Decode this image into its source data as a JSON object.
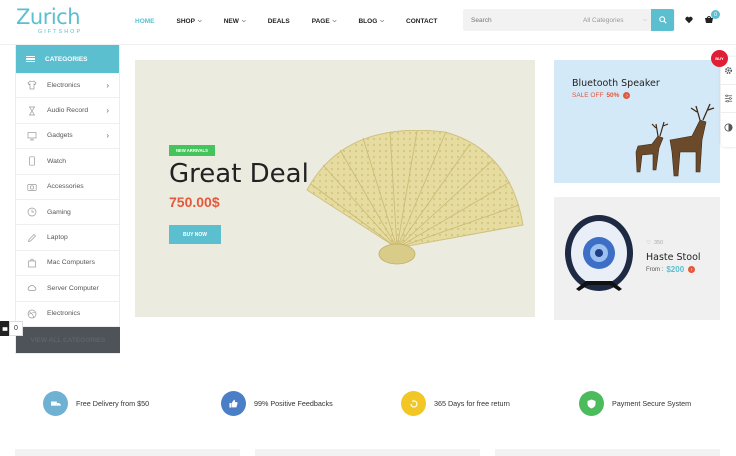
{
  "brand": {
    "name": "Zurich",
    "tagline": "GIFTSHOP",
    "accent": "#5bbfd0"
  },
  "nav": [
    {
      "label": "HOME",
      "active": true,
      "dropdown": false
    },
    {
      "label": "SHOP",
      "active": false,
      "dropdown": true
    },
    {
      "label": "NEW",
      "active": false,
      "dropdown": true
    },
    {
      "label": "DEALS",
      "active": false,
      "dropdown": false
    },
    {
      "label": "PAGE",
      "active": false,
      "dropdown": true
    },
    {
      "label": "BLOG",
      "active": false,
      "dropdown": true
    },
    {
      "label": "CONTACT",
      "active": false,
      "dropdown": false
    }
  ],
  "search": {
    "placeholder": "Search",
    "category": "All Categories"
  },
  "cart": {
    "count": "0"
  },
  "sidebar": {
    "title": "CATEGORIES",
    "items": [
      {
        "label": "Electronics",
        "icon": "tshirt-icon",
        "has_sub": true
      },
      {
        "label": "Audio Record",
        "icon": "hourglass-icon",
        "has_sub": true
      },
      {
        "label": "Gadgets",
        "icon": "monitor-icon",
        "has_sub": true
      },
      {
        "label": "Watch",
        "icon": "phone-icon",
        "has_sub": false
      },
      {
        "label": "Accessories",
        "icon": "camera-icon",
        "has_sub": false
      },
      {
        "label": "Gaming",
        "icon": "clock-icon",
        "has_sub": false
      },
      {
        "label": "Laptop",
        "icon": "pencil-icon",
        "has_sub": false
      },
      {
        "label": "Mac Computers",
        "icon": "bag-icon",
        "has_sub": false
      },
      {
        "label": "Server Computer",
        "icon": "cloud-icon",
        "has_sub": false
      },
      {
        "label": "Electronics",
        "icon": "dribbble-icon",
        "has_sub": false
      }
    ],
    "footer": "VIEW ALL CATEGORIES"
  },
  "side_counter": "0",
  "hero": {
    "badge": "NEW ARRIVALS",
    "title": "Great Deal",
    "price": "750.00$",
    "button": "BUY NOW"
  },
  "banner1": {
    "title": "Bluetooth Speaker",
    "sale_prefix": "SALE OFF",
    "sale_value": "50%"
  },
  "banner2": {
    "likes": "350",
    "title": "Haste Stool",
    "from": "From :",
    "price": "$200"
  },
  "buy_badge": "BUY",
  "features": [
    {
      "text": "Free Delivery from $50",
      "color": "#6fb1d3",
      "icon": "truck-icon"
    },
    {
      "text": "99% Positive Feedbacks",
      "color": "#4a7fc7",
      "icon": "thumbs-up-icon"
    },
    {
      "text": "365 Days for free return",
      "color": "#f2c624",
      "icon": "return-icon"
    },
    {
      "text": "Payment Secure System",
      "color": "#4cbb5c",
      "icon": "shield-icon"
    }
  ],
  "colors": {
    "sale": "#e4583b",
    "badge_green": "#44c45a",
    "dark_footer": "#4e5259"
  }
}
